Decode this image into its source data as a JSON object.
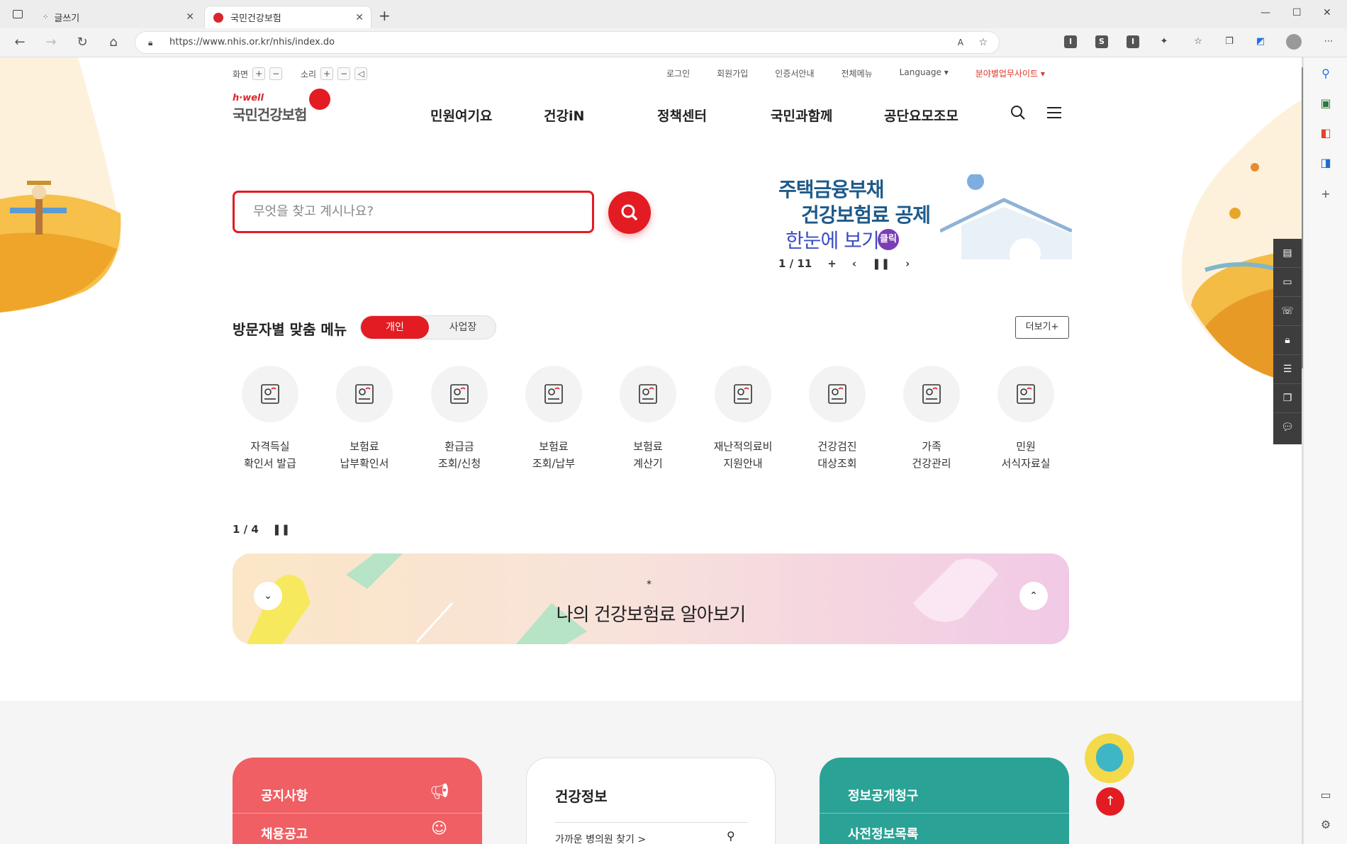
{
  "browser": {
    "tabs": [
      {
        "label": "글쓰기"
      },
      {
        "label": "국민건강보험"
      }
    ],
    "url": "https://www.nhis.or.kr/nhis/index.do"
  },
  "util": {
    "screen_label": "화면",
    "sound_label": "소리",
    "links": [
      "로그인",
      "회원가입",
      "인증서안내",
      "전체메뉴",
      "Language ▾",
      "분야별업무사이트 ▾"
    ]
  },
  "logo": {
    "brand": "h·well",
    "name": "국민건강보험"
  },
  "gnb": [
    "민원여기요",
    "건강iN",
    "정책센터",
    "국민과함께",
    "공단요모조모"
  ],
  "search": {
    "placeholder": "무엇을 찾고 계시나요?"
  },
  "banner": {
    "line1": "주택금융부채",
    "line2": "건강보험료 공제",
    "line3": "한눈에 보기",
    "badge": "클릭",
    "pager": "1 / 11"
  },
  "visitor": {
    "title": "방문자별 맞춤 메뉴",
    "tab_personal": "개인",
    "tab_business": "사업장",
    "more": "더보기+"
  },
  "menus": [
    {
      "label": "자격득실\n확인서 발급",
      "icon": "id-card-icon"
    },
    {
      "label": "보험료\n납부확인서",
      "icon": "document-search-icon"
    },
    {
      "label": "환급금\n조회/신청",
      "icon": "monitor-won-icon"
    },
    {
      "label": "보험료\n조회/납부",
      "icon": "monitor-heart-icon"
    },
    {
      "label": "보험료\n계산기",
      "icon": "calculator-icon"
    },
    {
      "label": "재난적의료비\n지원안내",
      "icon": "money-up-icon"
    },
    {
      "label": "건강검진\n대상조회",
      "icon": "people-check-icon"
    },
    {
      "label": "가족\n건강관리",
      "icon": "family-heart-icon"
    },
    {
      "label": "민원\n서식자료실",
      "icon": "form-check-icon"
    }
  ],
  "promo": {
    "pager": "1 / 4",
    "title": "나의 건강보험료 알아보기"
  },
  "cards": {
    "notice": {
      "row1": "공지사항",
      "row2": "채용공고"
    },
    "health": {
      "title": "건강정보",
      "link": "가까운 병의원 찾기 >"
    },
    "open": {
      "row1": "정보공개청구",
      "row2": "사전정보목록"
    }
  },
  "colors": {
    "accent": "#e31b23",
    "notice": "#ef5f63",
    "open": "#2aa296"
  }
}
